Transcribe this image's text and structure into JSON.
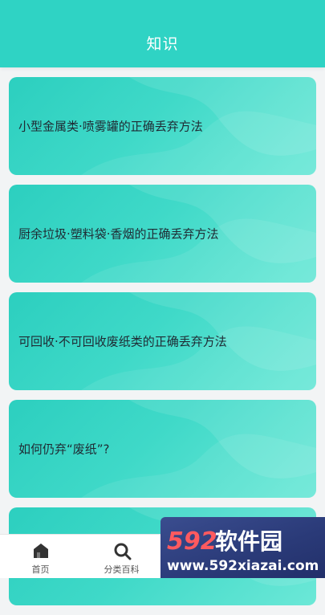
{
  "header": {
    "title": "知识",
    "color": "#2fd3c4"
  },
  "cards": [
    {
      "title": "小型金属类·喷雾罐的正确丢弃方法"
    },
    {
      "title": "厨余垃圾·塑料袋·香烟的正确丢弃方法"
    },
    {
      "title": "可回收·不可回收废纸类的正确丢弃方法"
    },
    {
      "title": "如何仍弃“废纸”?"
    },
    {
      "title": ""
    }
  ],
  "tabbar": {
    "tabs": [
      {
        "label": "首页",
        "icon": "home-icon"
      },
      {
        "label": "分类百科",
        "icon": "search-icon"
      },
      {
        "label": "",
        "icon": "knowledge-icon"
      },
      {
        "label": "",
        "icon": "user-icon"
      }
    ]
  },
  "watermark": {
    "brand": "592软件园",
    "url": "www.592xiazai.com"
  }
}
